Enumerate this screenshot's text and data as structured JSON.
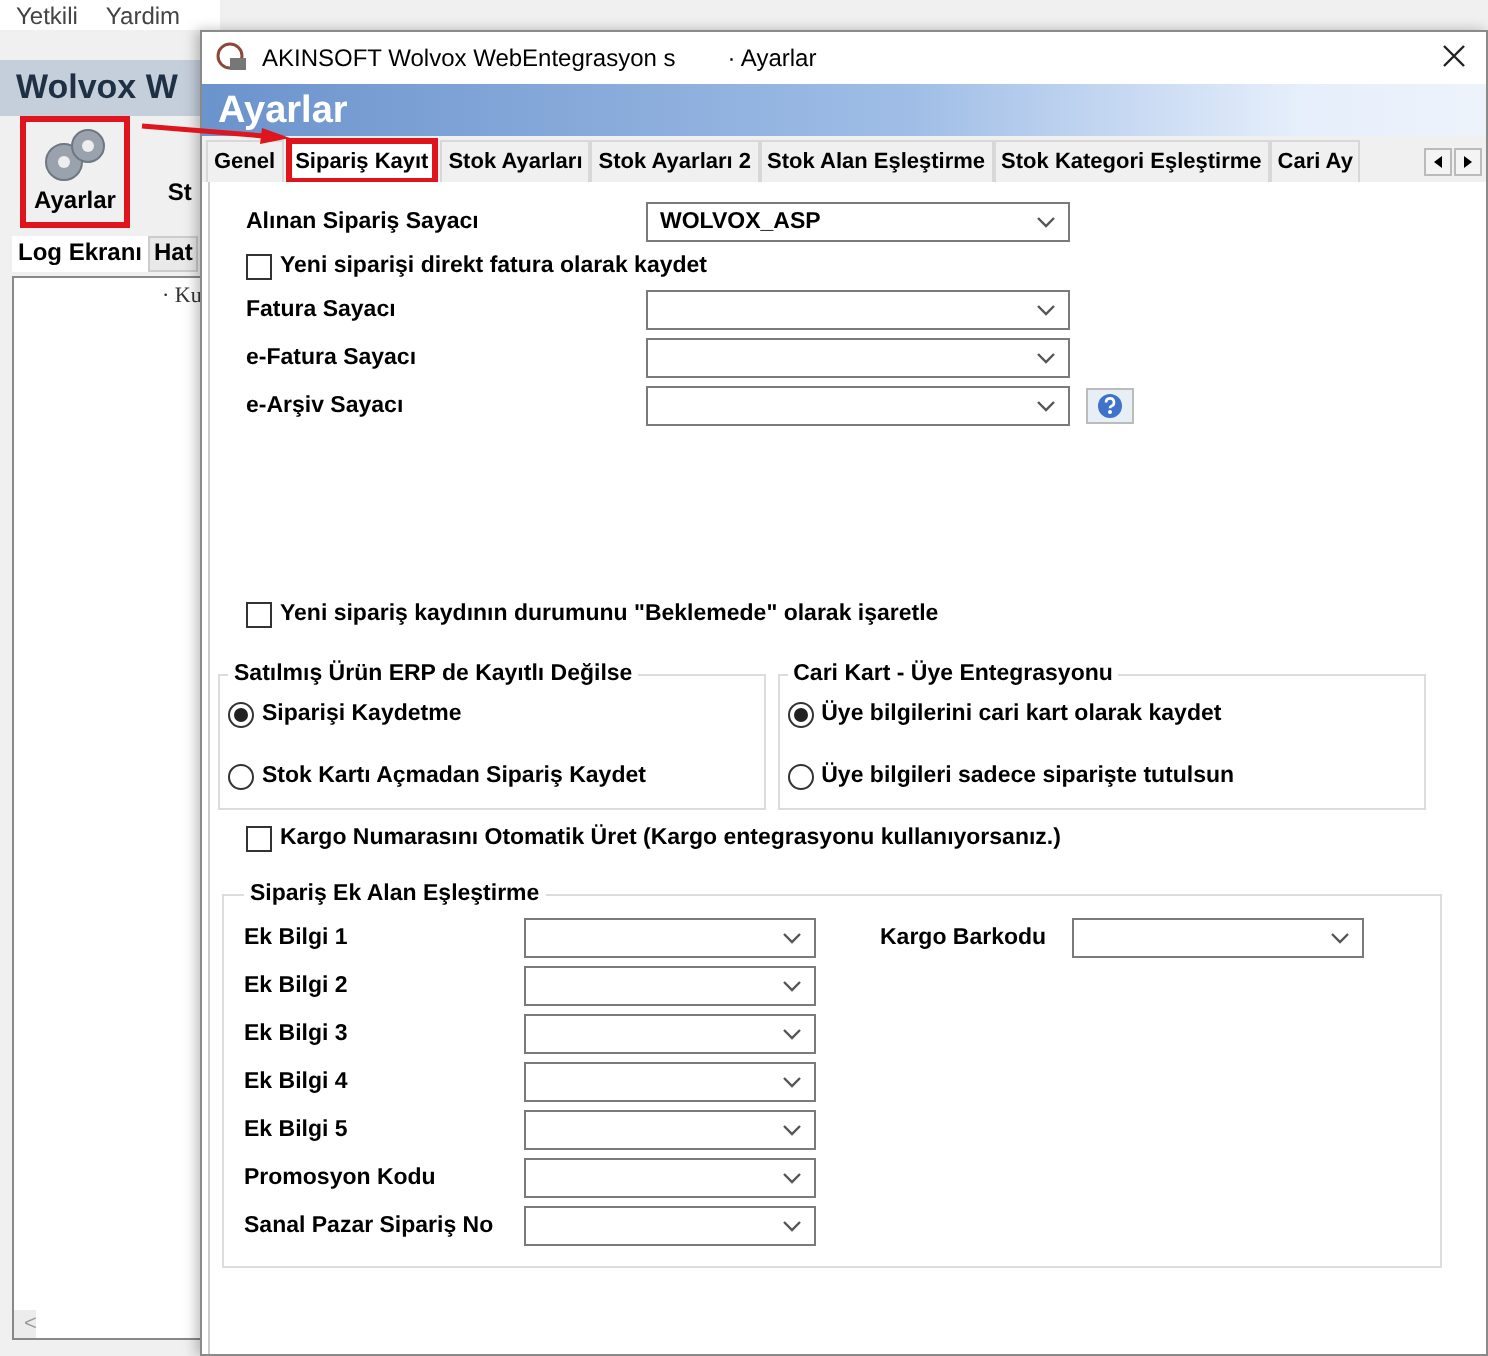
{
  "menu": [
    "Yetkili",
    "Yardim"
  ],
  "app": {
    "title": "Wolvox W",
    "toolbar": [
      {
        "label": "Ayarlar",
        "highlighted": true
      },
      {
        "label": "St",
        "highlighted": false
      }
    ],
    "tabs": [
      {
        "label": "Log Ekranı",
        "selected": true
      },
      {
        "label": "Hat",
        "selected": false
      }
    ],
    "log_text": "· Ku",
    "scroll_left": "<"
  },
  "dialog": {
    "title": "AKINSOFT Wolvox WebEntegrasyon s",
    "title_suffix": "· Ayarlar",
    "header": "Ayarlar",
    "tabs": [
      {
        "label": "Genel",
        "selected": false,
        "highlighted": false
      },
      {
        "label": "Sipariş Kayıt",
        "selected": true,
        "highlighted": true
      },
      {
        "label": "Stok Ayarları",
        "selected": false,
        "highlighted": false
      },
      {
        "label": "Stok Ayarları 2",
        "selected": false,
        "highlighted": false
      },
      {
        "label": "Stok Alan Eşleştirme",
        "selected": false,
        "highlighted": false
      },
      {
        "label": "Stok Kategori Eşleştirme",
        "selected": false,
        "highlighted": false
      },
      {
        "label": "Cari Ay",
        "selected": false,
        "highlighted": false
      }
    ],
    "settings": [
      {
        "kind": "combo",
        "label": "Alınan Sipariş Sayacı",
        "value": "WOLVOX_ASP"
      },
      {
        "kind": "check",
        "label": "Yeni siparişi direkt fatura olarak kaydet",
        "checked": false
      },
      {
        "kind": "combo",
        "label": "Fatura Sayacı"
      },
      {
        "kind": "combo",
        "label": "e-Fatura Sayacı"
      },
      {
        "kind": "combo",
        "label": "e-Arşiv Sayacı",
        "help": true
      }
    ],
    "pending_check": {
      "label": "Yeni sipariş kaydının durumunu \"Beklemede\" olarak işaretle",
      "checked": false
    },
    "groups": [
      {
        "title": "Satılmış Ürün ERP de Kayıtlı Değilse",
        "options": [
          {
            "label": "Siparişi Kaydetme",
            "selected": true
          },
          {
            "label": "Stok Kartı Açmadan Sipariş Kaydet",
            "selected": false
          }
        ]
      },
      {
        "title": "Cari Kart - Üye Entegrasyonu",
        "options": [
          {
            "label": "Üye bilgilerini cari kart olarak kaydet",
            "selected": true
          },
          {
            "label": "Üye bilgileri sadece siparişte tutulsun",
            "selected": false
          }
        ]
      }
    ],
    "cargo_check": {
      "label": "Kargo Numarasını Otomatik Üret (Kargo entegrasyonu kullanıyorsanız.)",
      "checked": false
    },
    "extra": {
      "title": "Sipariş Ek Alan Eşleştirme",
      "fields": [
        {
          "label": "Ek Bilgi 1"
        },
        {
          "label": "Ek Bilgi 2"
        },
        {
          "label": "Ek Bilgi 3"
        },
        {
          "label": "Ek Bilgi 4"
        },
        {
          "label": "Ek Bilgi 5"
        },
        {
          "label": "Promosyon Kodu"
        },
        {
          "label": "Sanal Pazar Sipariş No"
        }
      ],
      "side_fields": [
        {
          "label": "Kargo Barkodu"
        }
      ]
    }
  }
}
